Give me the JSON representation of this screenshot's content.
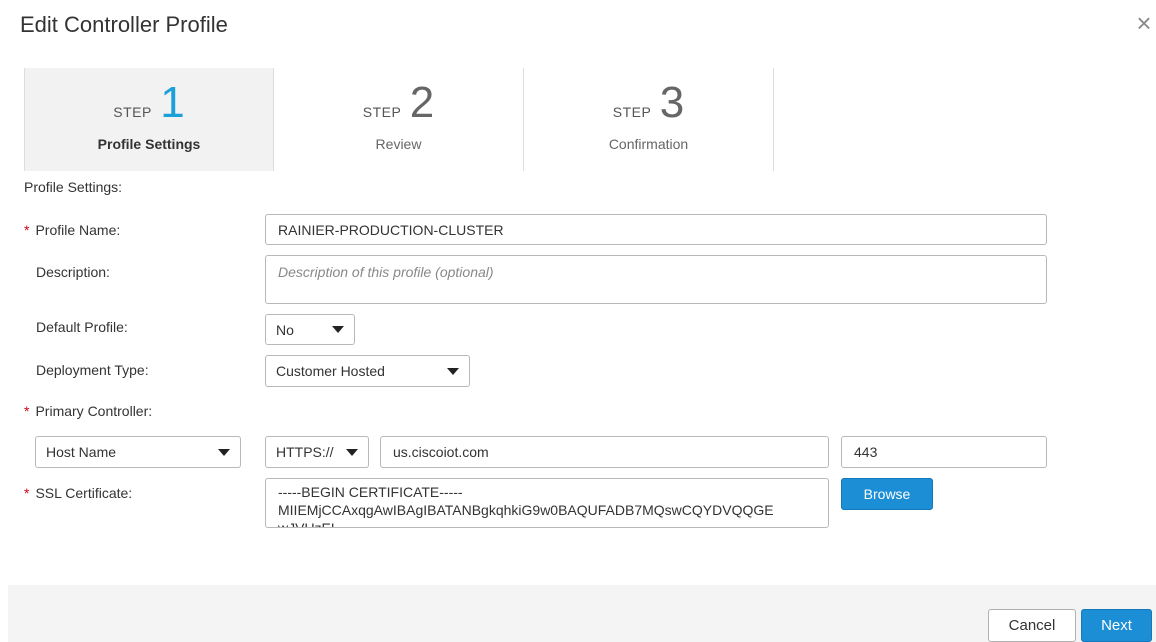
{
  "dialog": {
    "title": "Edit Controller Profile",
    "close_icon": "×"
  },
  "stepper": {
    "steps": [
      {
        "word": "STEP",
        "number": "1",
        "label": "Profile Settings",
        "active": true
      },
      {
        "word": "STEP",
        "number": "2",
        "label": "Review",
        "active": false
      },
      {
        "word": "STEP",
        "number": "3",
        "label": "Confirmation",
        "active": false
      }
    ]
  },
  "form": {
    "section_label": "Profile Settings:",
    "required_marker": "*",
    "profile_name": {
      "label": "Profile Name:",
      "value": "RAINIER-PRODUCTION-CLUSTER"
    },
    "description": {
      "label": "Description:",
      "placeholder": "Description of this profile (optional)"
    },
    "default_profile": {
      "label": "Default Profile:",
      "value": "No"
    },
    "deployment_type": {
      "label": "Deployment Type:",
      "value": "Customer Hosted"
    },
    "primary_controller": {
      "label": "Primary Controller:",
      "address_type": "Host Name",
      "protocol": "HTTPS://",
      "host": "us.ciscoiot.com",
      "port": "443"
    },
    "ssl_certificate": {
      "label": "SSL Certificate:",
      "line1": "-----BEGIN CERTIFICATE-----",
      "line2": "MIIEMjCCAxqgAwIBAgIBATANBgkqhkiG9w0BAQUFADB7MQswCQYDVQQGE",
      "line3": "wJVUzEL",
      "browse_label": "Browse"
    }
  },
  "footer": {
    "cancel_label": "Cancel",
    "next_label": "Next"
  },
  "colors": {
    "accent": "#1ba0d7",
    "primary_button": "#1b8ed6",
    "required": "#d0021b"
  }
}
